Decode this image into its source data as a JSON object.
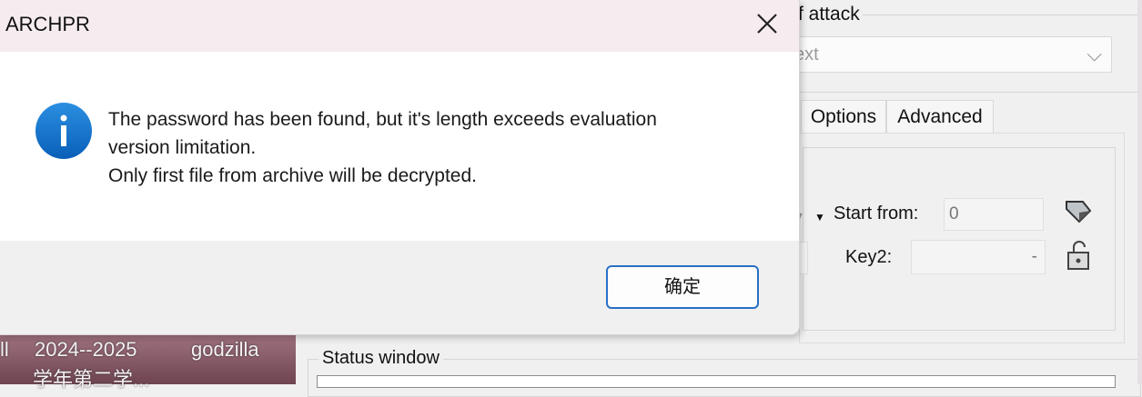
{
  "dialog": {
    "title": "ARCHPR",
    "message_line1": "The password has been found, but it's length exceeds evaluation",
    "message_line2": "version limitation.",
    "message_line3": "Only first file from archive will be decrypted.",
    "ok_label": "确定",
    "icon": "info-icon",
    "accent_color": "#2a6fc7"
  },
  "background": {
    "attack_group_title": "f attack",
    "attack_combo_value": "ext",
    "tabs": [
      {
        "label": "Options"
      },
      {
        "label": "Advanced"
      }
    ],
    "start_from_label": "Start from:",
    "start_from_value": "0",
    "key2_label": "Key2:",
    "key2_value": "-",
    "status_window_title": "Status window",
    "desktop_text1": "ll",
    "desktop_text2": "2024--2025",
    "desktop_text3": "godzilla",
    "desktop_text4": "学年第二学..."
  }
}
